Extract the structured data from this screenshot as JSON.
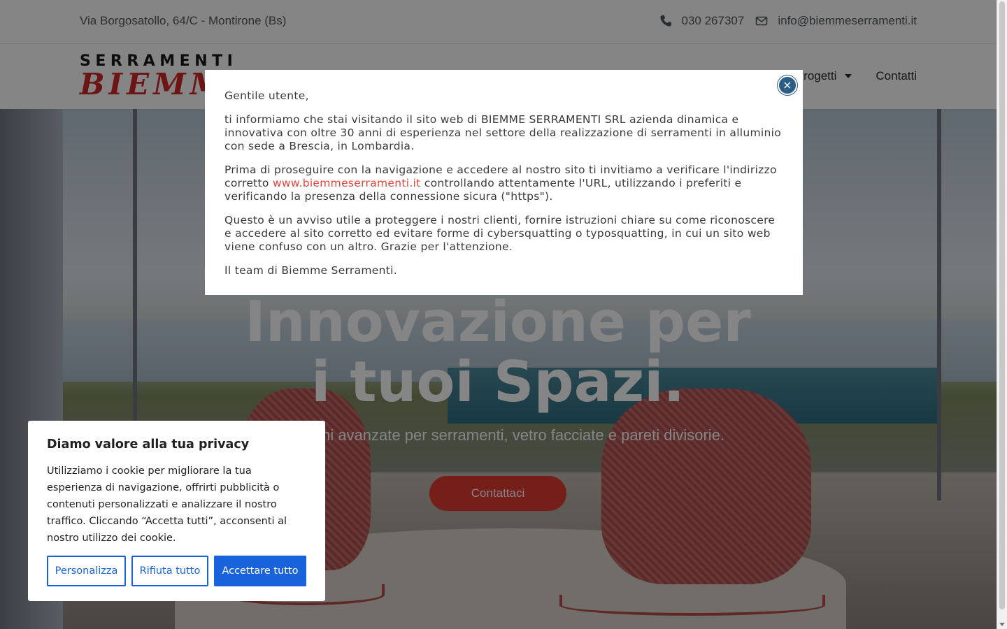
{
  "topbar": {
    "address": "Via Borgosatollo, 64/C - Montirone (Bs)",
    "phone": "030 267307",
    "email": "info@biemmeserramenti.it"
  },
  "header": {
    "logo_top": "SERRAMENTI",
    "logo_bottom": "BIEMME",
    "nav": [
      {
        "label": "Progetti",
        "has_dropdown": true
      },
      {
        "label": "Contatti",
        "has_dropdown": false
      }
    ]
  },
  "hero": {
    "title_line1": "Innovazione per",
    "title_line2": "i tuoi Spazi.",
    "subtitle": "Soluzioni avanzate per serramenti, vetro facciate e pareti divisorie.",
    "cta_label": "Contattaci"
  },
  "modal": {
    "greeting": "Gentile utente,",
    "para1": "ti informiamo che stai visitando il sito web di BIEMME SERRAMENTI SRL azienda dinamica e innovativa con oltre 30 anni di esperienza nel settore della realizzazione di serramenti in alluminio con sede a Brescia, in Lombardia.",
    "para2_before": "Prima di proseguire con la navigazione e accedere al nostro sito ti invitiamo a verificare l'indirizzo corretto ",
    "para2_link": "www.biemmeserramenti.it",
    "para2_after": " controllando attentamente l'URL, utilizzando i preferiti e verificando la presenza della connessione sicura (\"https\").",
    "para3": "Questo è un avviso utile a proteggere i nostri clienti, fornire istruzioni chiare su come riconoscere e accedere al sito corretto ed evitare forme di cybersquatting o typosquatting, in cui un sito web viene confuso con un altro. Grazie per l'attenzione.",
    "signature": "Il team di Biemme Serramenti.",
    "close_glyph": "×"
  },
  "cookie": {
    "title": "Diamo valore alla tua privacy",
    "text": "Utilizziamo i cookie per migliorare la tua esperienza di navigazione, offrirti pubblicità o contenuti personalizzati e analizzare il nostro traffico. Cliccando “Accetta tutti”, acconsenti al nostro utilizzo dei cookie.",
    "customize_label": "Personalizza",
    "reject_label": "Rifiuta tutto",
    "accept_label": "Accettare tutto"
  },
  "colors": {
    "accent_red": "#e23b32",
    "cookie_blue": "#1863dc",
    "close_blue": "#2c5d87"
  }
}
